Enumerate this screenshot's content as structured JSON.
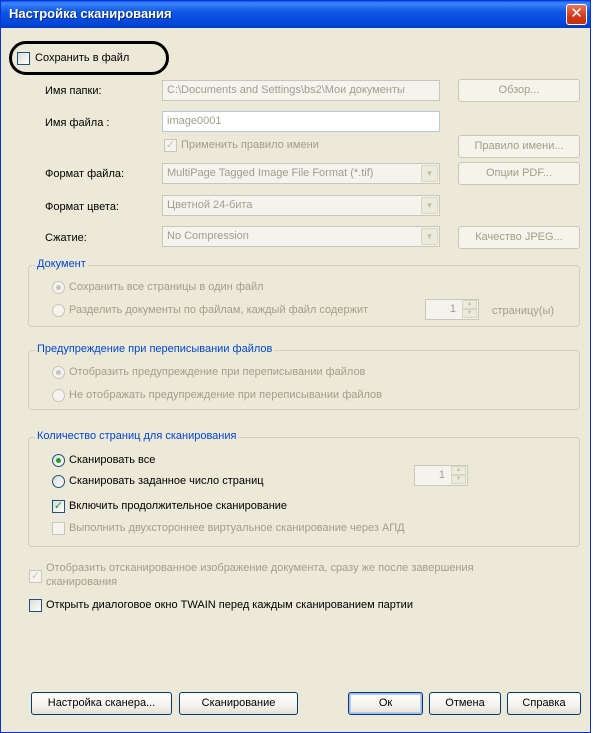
{
  "window": {
    "title": "Настройка сканирования",
    "close_glyph": "✕"
  },
  "save_to_file": {
    "label": "Сохранить в файл",
    "checked": false
  },
  "folder": {
    "label": "Имя папки:",
    "value": "C:\\Documents and Settings\\bs2\\Мои документы",
    "browse_label": "Обзор..."
  },
  "file_name": {
    "label": "Имя файла :",
    "value": "image0001"
  },
  "apply_rule": {
    "label": "Применить правило имени",
    "checked": true,
    "rule_button": "Правило имени..."
  },
  "file_format": {
    "label": "Формат файла:",
    "value": "MultiPage Tagged Image File Format (*.tif)",
    "pdf_button": "Опции PDF..."
  },
  "color_format": {
    "label": "Формат цвета:",
    "value": "Цветной 24-бита"
  },
  "compression": {
    "label": "Сжатие:",
    "value": "No Compression",
    "jpeg_button": "Качество JPEG..."
  },
  "document_group": {
    "caption": "Документ",
    "opt1": "Сохранить все страницы в один файл",
    "opt2": "Разделить документы по файлам, каждый файл содержит",
    "pages_value": "1",
    "pages_suffix": "страницу(ы)"
  },
  "overwrite_group": {
    "caption": "Предупреждение при переписывании файлов",
    "opt1": "Отобразить предупреждение при переписывании файлов",
    "opt2": "Не отображать предупреждение при переписывании файлов"
  },
  "pages_group": {
    "caption": "Количество страниц для сканирования",
    "opt1": "Сканировать все",
    "opt2": "Сканировать заданное число страниц",
    "count_value": "1",
    "continuous": "Включить продолжительное сканирование",
    "duplex": "Выполнить двухстороннее виртуальное сканирование через АПД"
  },
  "show_image": {
    "line1": "Отобразить отсканированное изображение документа, сразу же после завершения",
    "line2": "сканирования"
  },
  "twain_dialog": {
    "label": "Открыть диалоговое окно TWAIN перед каждым сканированием партии"
  },
  "buttons": {
    "scanner_setup": "Настройка сканера...",
    "scan": "Сканирование",
    "ok": "Ок",
    "cancel": "Отмена",
    "help": "Справка"
  },
  "colors": {
    "title_bar": "#0246d8",
    "dialog_bg": "#ece9d8",
    "group_caption": "#0046d5",
    "check_mark": "#21a121"
  }
}
